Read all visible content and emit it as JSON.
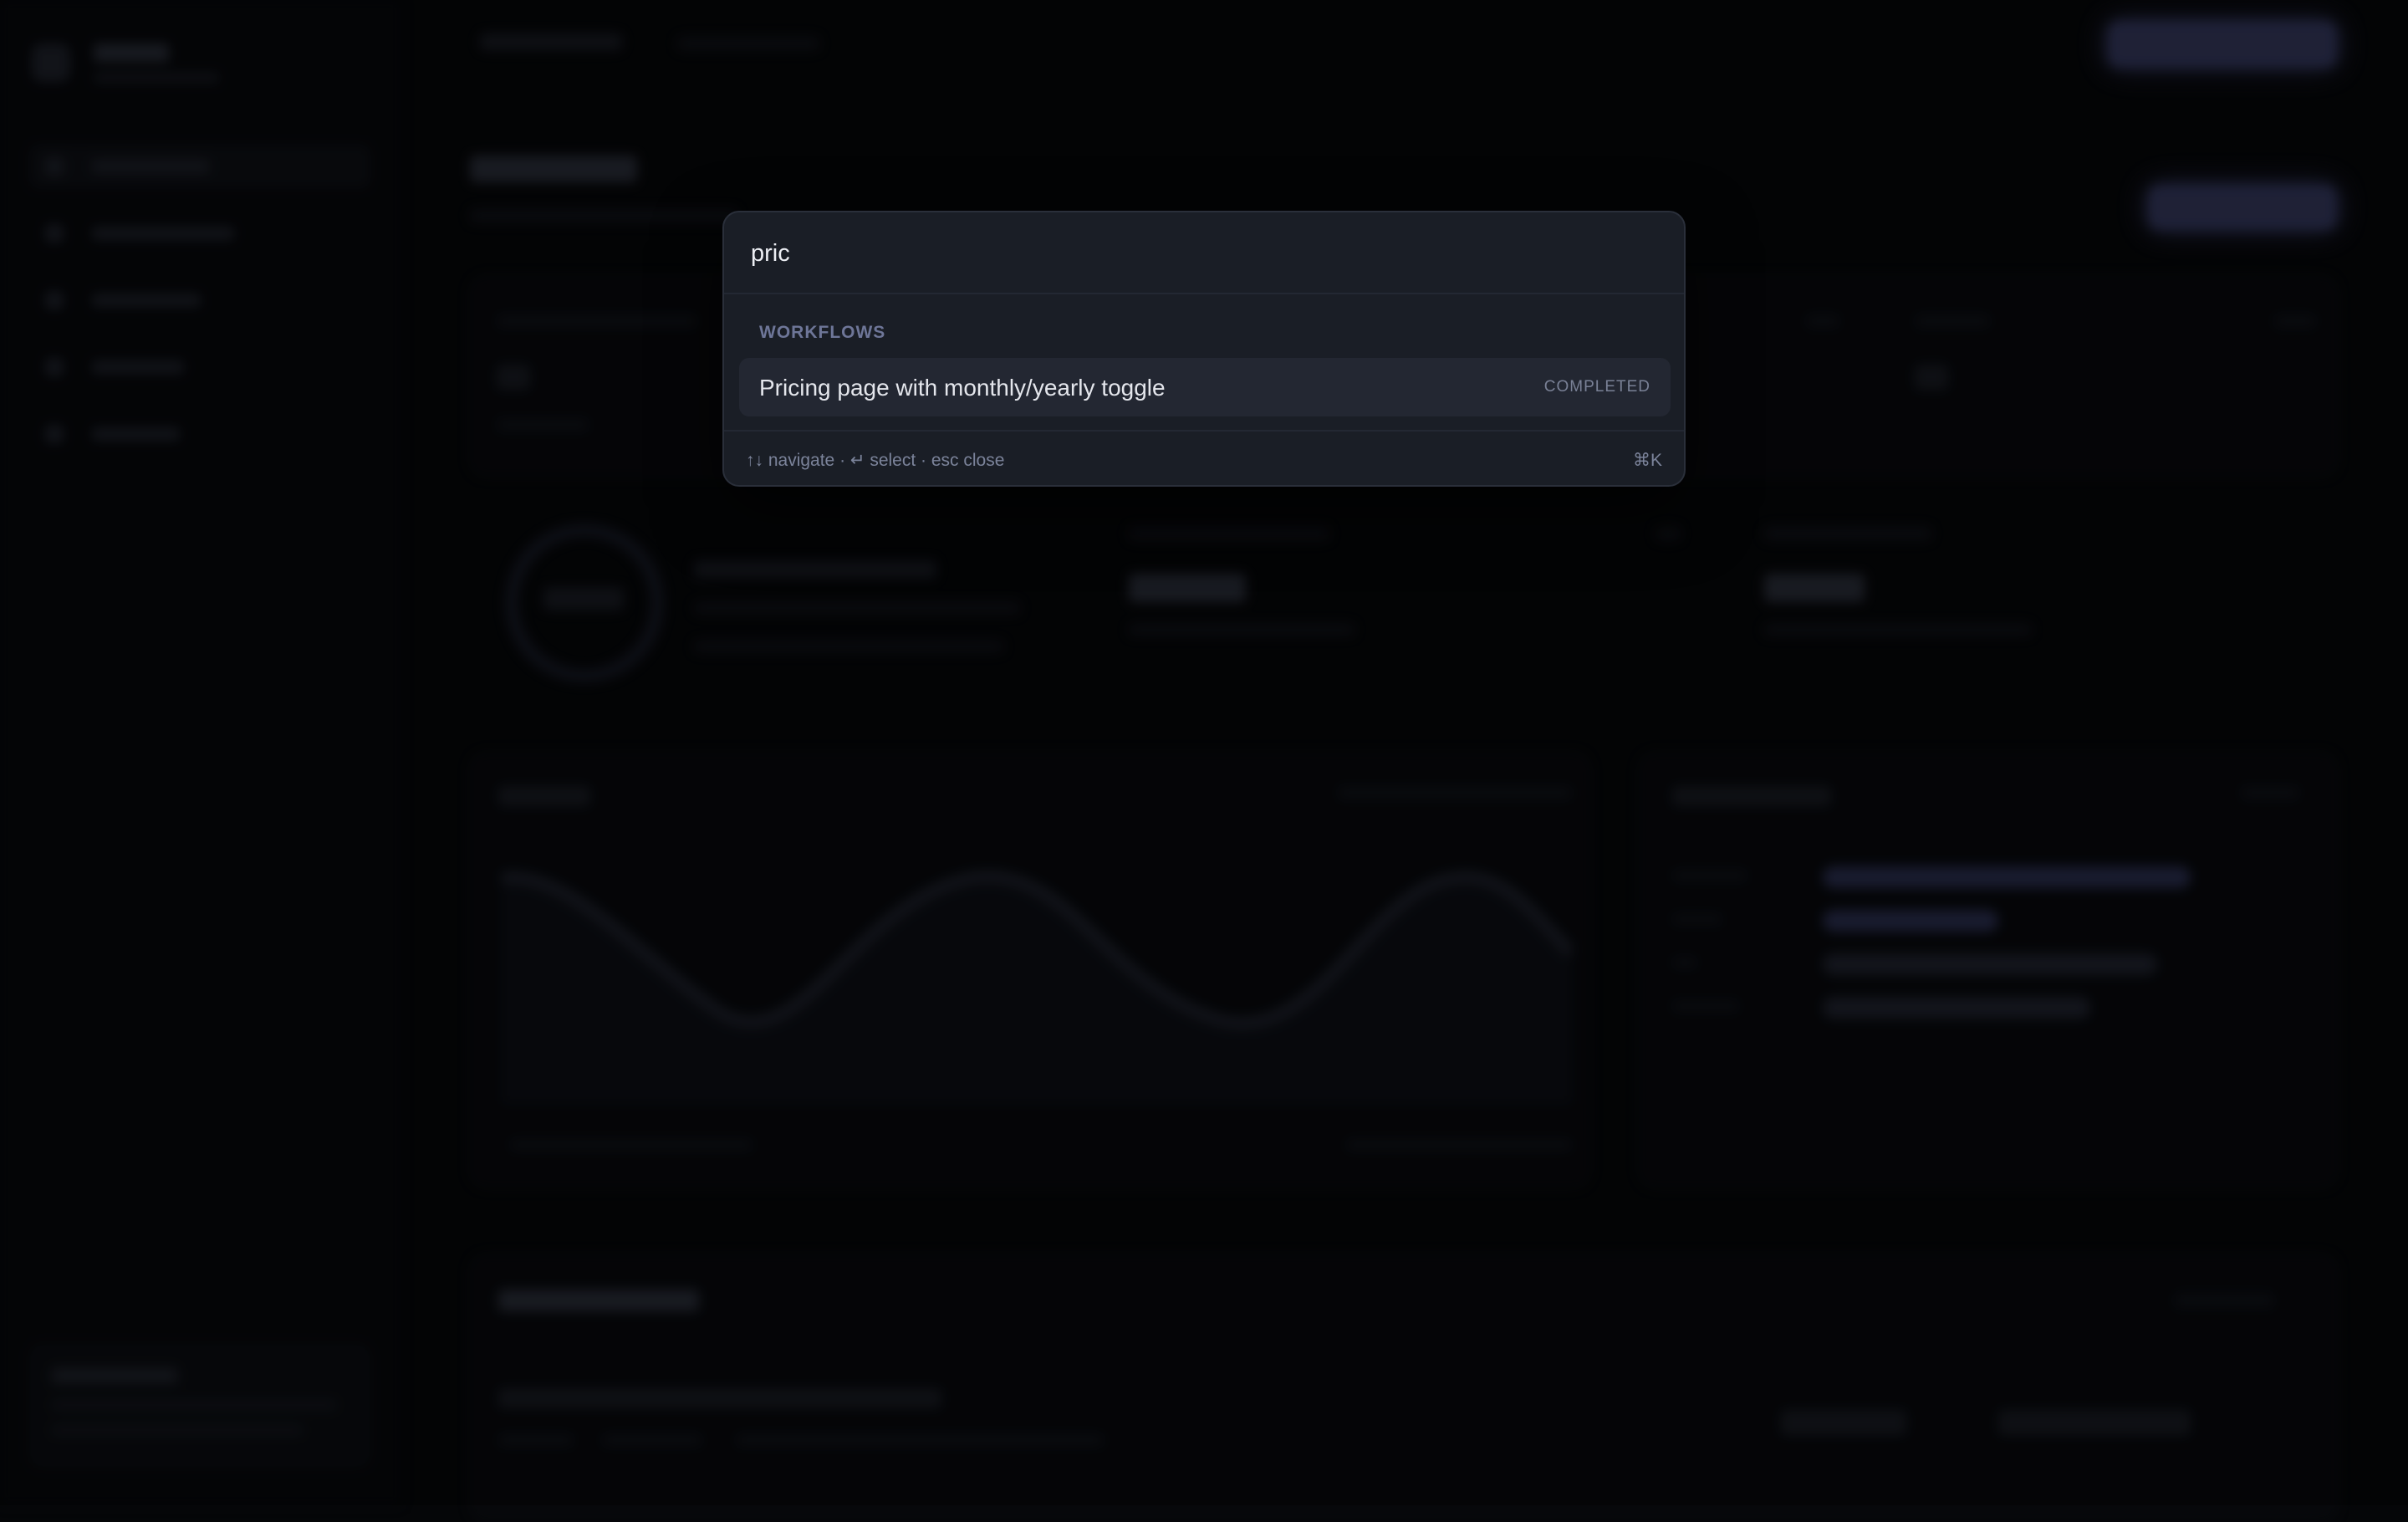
{
  "command_palette": {
    "query": "pric",
    "section_label": "WORKFLOWS",
    "results": [
      {
        "title": "Pricing page with monthly/yearly toggle",
        "status": "COMPLETED"
      }
    ],
    "footer_hint": "↑↓ navigate · ↵ select · esc close",
    "shortcut": "⌘K"
  },
  "colors": {
    "backdrop": "#050608",
    "palette_bg": "#1a1e26",
    "selected_item_bg": "#232732",
    "section_label": "#6e7698",
    "accent": "#4a4f85"
  },
  "icons": [
    "logo-icon",
    "nav-item-icon"
  ]
}
